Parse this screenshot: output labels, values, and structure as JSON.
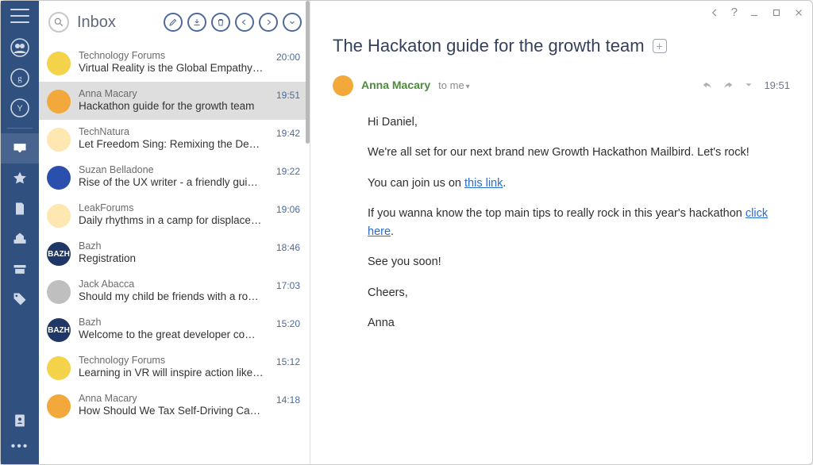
{
  "rail": {
    "menu_name": "hamburger-icon",
    "accounts": [
      {
        "id": "contacts",
        "name": "account-contacts-icon"
      },
      {
        "id": "google",
        "name": "account-google-icon"
      },
      {
        "id": "yahoo",
        "name": "account-yahoo-icon"
      }
    ],
    "folders": [
      {
        "id": "inbox",
        "name": "folder-inbox",
        "selected": true
      },
      {
        "id": "starred",
        "name": "folder-starred"
      },
      {
        "id": "drafts",
        "name": "folder-drafts"
      },
      {
        "id": "sent",
        "name": "folder-sent"
      },
      {
        "id": "archive",
        "name": "folder-archive"
      },
      {
        "id": "tags",
        "name": "folder-tags"
      }
    ],
    "bottom": {
      "addressbook": "addressbook-icon",
      "more": "more-icon"
    }
  },
  "list": {
    "folder_title": "Inbox",
    "search_placeholder": "Search",
    "actions": [
      "compose",
      "download",
      "delete",
      "reply",
      "forward",
      "more"
    ],
    "rows": [
      {
        "sender": "Technology Forums",
        "subject": "Virtual Reality is the Global Empathy Ma…",
        "time": "20:00",
        "avatar": {
          "cls": "av-yellow",
          "label": ""
        }
      },
      {
        "sender": "Anna Macary",
        "subject": "Hackathon guide for the growth team",
        "time": "19:51",
        "avatar": {
          "cls": "av-orange",
          "label": ""
        },
        "selected": true
      },
      {
        "sender": "TechNatura",
        "subject": "Let Freedom Sing: Remixing the Declarati…",
        "time": "19:42",
        "avatar": {
          "cls": "av-pale",
          "label": ""
        }
      },
      {
        "sender": "Suzan Belladone",
        "subject": "Rise of the UX writer - a friendly guide of…",
        "time": "19:22",
        "avatar": {
          "cls": "av-blue",
          "label": ""
        }
      },
      {
        "sender": "LeakForums",
        "subject": "Daily rhythms in a camp for displaced pe…",
        "time": "19:06",
        "avatar": {
          "cls": "av-pale",
          "label": ""
        }
      },
      {
        "sender": "Bazh",
        "subject": "Registration",
        "time": "18:46",
        "avatar": {
          "cls": "av-navy",
          "label": "BAZH"
        }
      },
      {
        "sender": "Jack Abacca",
        "subject": "Should my child be friends with a robot…",
        "time": "17:03",
        "avatar": {
          "cls": "av-grey",
          "label": ""
        }
      },
      {
        "sender": "Bazh",
        "subject": "Welcome to the great developer commu…",
        "time": "15:20",
        "avatar": {
          "cls": "av-navy",
          "label": "BAZH"
        }
      },
      {
        "sender": "Technology Forums",
        "subject": "Learning in VR will inspire action like nev…",
        "time": "15:12",
        "avatar": {
          "cls": "av-yellow",
          "label": ""
        }
      },
      {
        "sender": "Anna Macary",
        "subject": "How Should We Tax Self-Driving Cars?",
        "time": "14:18",
        "avatar": {
          "cls": "av-orange",
          "label": ""
        }
      }
    ]
  },
  "reader": {
    "window_controls": [
      "back",
      "help",
      "minimize",
      "maximize",
      "close"
    ],
    "title": "The Hackaton guide for the growth team",
    "from": "Anna Macary",
    "to": "to me",
    "time": "19:51",
    "actions": [
      "reply",
      "forward",
      "more"
    ],
    "body": {
      "p1": "Hi Daniel,",
      "p2a": "We're all set for our next brand new Growth Hackathon Mailbird. Let's rock!",
      "p3a": "You can join us on ",
      "p3_link": "this link",
      "p3b": ".",
      "p4a": "If you wanna know the top main tips to really rock in this year's hackathon ",
      "p4_link": "click here",
      "p4b": ".",
      "p5": "See you soon!",
      "p6": "Cheers,",
      "p7": "Anna"
    }
  }
}
